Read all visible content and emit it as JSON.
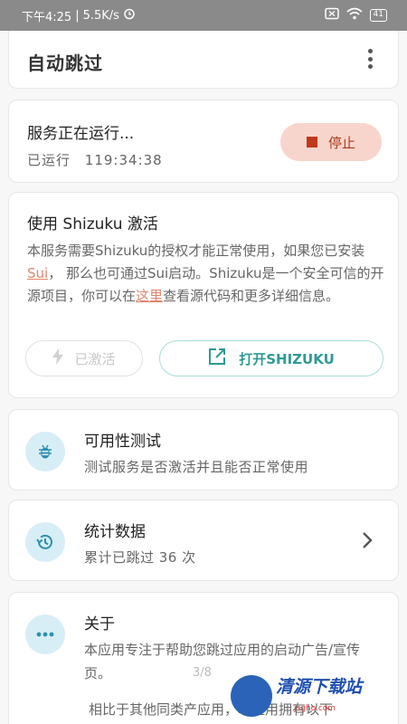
{
  "status_bar": {
    "time": "下午4:25",
    "speed": "5.5K/s",
    "battery": "41"
  },
  "app": {
    "title": "自动跳过"
  },
  "service": {
    "status_text": "服务正在运行...",
    "runtime_label": "已运行",
    "runtime_value": "119:34:38",
    "stop_label": "停止"
  },
  "shizuku": {
    "title": "使用 Shizuku 激活",
    "desc_part1": "本服务需要Shizuku的授权才能正常使用，如果您已安装",
    "desc_link1": "Sui",
    "desc_part2": "， 那么也可通过Sui启动。Shizuku是一个安全可信的开源项目，你可以在",
    "desc_link2": "这里",
    "desc_part3": "查看源代码和更多详细信息。",
    "activated_label": "已激活",
    "open_label": "打开SHIZUKU"
  },
  "features": [
    {
      "title": "可用性测试",
      "subtitle": "测试服务是否激活并且能否正常使用",
      "icon": "bug-icon"
    },
    {
      "title": "统计数据",
      "subtitle": "累计已跳过 36 次",
      "icon": "history-icon"
    }
  ],
  "about": {
    "title": "关于",
    "desc": "本应用专注于帮助您跳过应用的启动广告/宣传页。",
    "more": "相比于其他同类产应用，本应用拥有以下"
  },
  "page_indicator": "3/8",
  "watermark": {
    "text": "清源下载站",
    "url": "jsgho.com"
  },
  "colors": {
    "stop_bg": "#f8d5cc",
    "stop_fg": "#c0391a",
    "accent": "#2f9a93",
    "icon_bg": "#d8eef6"
  }
}
